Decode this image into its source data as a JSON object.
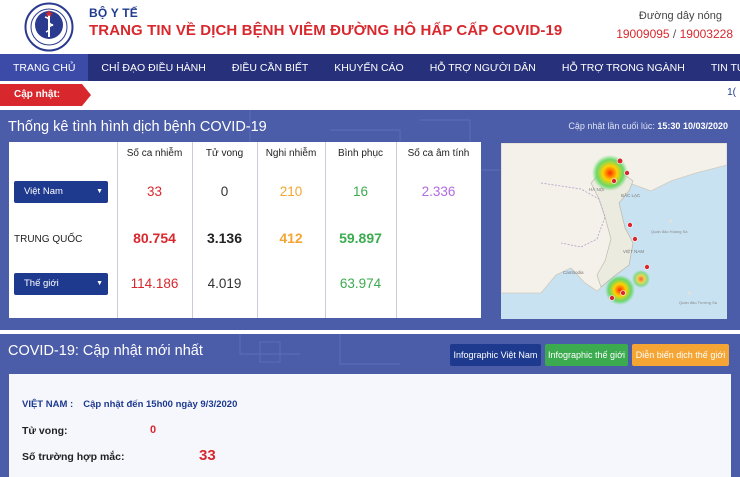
{
  "header": {
    "org": "BỘ Y TẾ",
    "title": "TRANG TIN VỀ DỊCH BỆNH VIÊM ĐƯỜNG HÔ HẤP CẤP COVID-19",
    "hotline_label": "Đường dây nóng",
    "hotline_1": "19009095",
    "hotline_sep": " / ",
    "hotline_2": "19003228"
  },
  "nav": {
    "items": [
      "TRANG CHỦ",
      "CHỈ ĐẠO ĐIỀU HÀNH",
      "ĐIỀU CẦN BIẾT",
      "KHUYẾN CÁO",
      "HỖ TRỢ NGƯỜI DÂN",
      "HỖ TRỢ TRONG NGÀNH",
      "TIN TỨC"
    ],
    "active": 0
  },
  "ticker": {
    "label": "Cập nhật:",
    "trailing": "1("
  },
  "stats": {
    "title": "Thống kê tình hình dịch bệnh COVID-19",
    "update_label": "Cập nhật lần cuối lúc:",
    "update_time": "15:30 10/03/2020",
    "columns": [
      "Số ca nhiễm",
      "Tử vong",
      "Nghi nhiễm",
      "Bình phục",
      "Số ca âm tính"
    ],
    "rows": [
      {
        "label": "Việt Nam",
        "selector": true,
        "values": [
          "33",
          "0",
          "210",
          "16",
          "2.336"
        ]
      },
      {
        "label": "TRUNG QUỐC",
        "selector": false,
        "values": [
          "80.754",
          "3.136",
          "412",
          "59.897",
          ""
        ]
      },
      {
        "label": "Thế giới",
        "selector": true,
        "values": [
          "114.186",
          "4.019",
          "",
          "63.974",
          ""
        ]
      }
    ]
  },
  "map": {
    "labels": [
      "HÀ NỘI",
      "BẮC LẠC",
      "VIỆT NAM",
      "Cambodia",
      "Quần đảo Hoàng Sa",
      "Quần đảo Trường Sa"
    ]
  },
  "news": {
    "title": "COVID-19: Cập nhật mới nhất",
    "buttons": [
      "Infographic Việt Nam",
      "Infographic thế giới",
      "Diễn biến dịch thế giới"
    ],
    "vn_label": "VIỆT NAM :",
    "vn_update": "Cập nhật đến 15h00 ngày 9/3/2020",
    "rows": [
      {
        "label": "Tử vong:",
        "value": "0"
      },
      {
        "label": "Số trường hợp mắc:",
        "value": "33"
      }
    ]
  },
  "colors": {
    "brand_red": "#d8282d",
    "brand_navy": "#27307a",
    "panel": "#4b5ca9",
    "infected": "#d8282d",
    "death": "#222222",
    "suspected": "#f4a533",
    "recovered": "#3cab50",
    "negative": "#b26be0"
  },
  "icons": [
    "ministry-logo-icon",
    "dropdown-caret-icon",
    "map-marker-icon"
  ]
}
